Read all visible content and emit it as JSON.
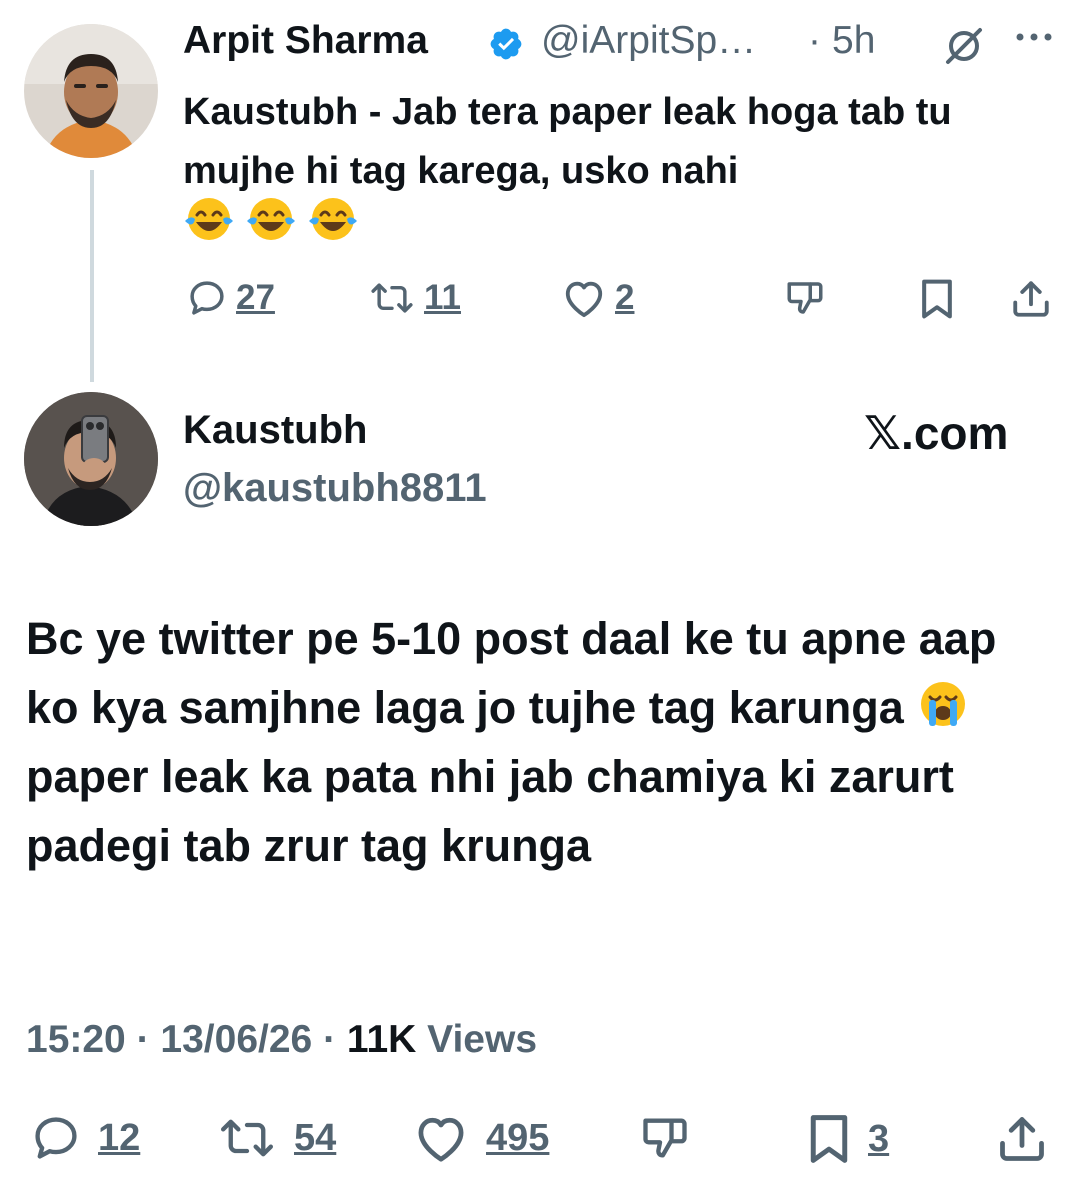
{
  "parent_tweet": {
    "author_name": "Arpit Sharma",
    "handle": "@iArpitSp…",
    "separator": "·",
    "time": "5h",
    "text": "Kaustubh - Jab tera paper leak hoga tab tu mujhe hi tag karega, usko nahi",
    "emoji_count": 3,
    "stats": {
      "replies": "27",
      "reposts": "11",
      "likes": "2"
    }
  },
  "main_tweet": {
    "author_name": "Kaustubh",
    "handle": "@kaustubh8811",
    "watermark": "𝕏.com",
    "text_part1": "Bc ye twitter pe 5-10 post daal ke tu apne aap ko kya samjhne laga jo tujhe tag karunga",
    "text_part2": "paper leak ka pata nhi jab chamiya ki zarurt padegi tab zrur tag krunga",
    "meta": {
      "time": "15:20",
      "separator": " · ",
      "date": "13/06/26",
      "views_count": "11K",
      "views_label": "Views"
    },
    "stats": {
      "replies": "12",
      "reposts": "54",
      "likes": "495",
      "bookmarks": "3"
    }
  },
  "colors": {
    "text": "#0f1419",
    "secondary": "#536471",
    "verified": "#1d9bf0",
    "thread_line": "#cfd9de"
  }
}
